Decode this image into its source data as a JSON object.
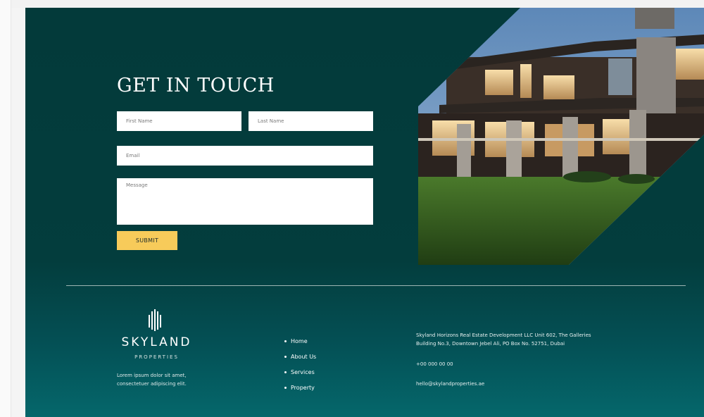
{
  "contact": {
    "title": "GET IN TOUCH",
    "first_name_placeholder": "First Name",
    "last_name_placeholder": "Last Name",
    "email_placeholder": "Email",
    "message_placeholder": "Message",
    "submit_label": "SUBMIT"
  },
  "hero_image": {
    "subject": "modern-villa-photo"
  },
  "footer": {
    "brand": {
      "name": "SKYLAND",
      "tagline": "PROPERTIES",
      "icon": "skyland-logo-icon"
    },
    "blurb": "Lorem ipsum dolor sit amet, consectetuer adipiscing elit.",
    "nav": [
      {
        "label": "Home"
      },
      {
        "label": "About Us"
      },
      {
        "label": "Services"
      },
      {
        "label": "Property"
      }
    ],
    "address": "Skyland Horizons Real Estate Development LLC Unit 602, The Galleries Building No.3, Downtown Jebel Ali, PO Box No. 52751, Dubai",
    "phone": "+00 000 00 00",
    "email": "hello@skylandproperties.ae"
  },
  "colors": {
    "background_teal": "#033a3a",
    "footer_teal": "#05676b",
    "accent_yellow": "#f7cb5a"
  }
}
